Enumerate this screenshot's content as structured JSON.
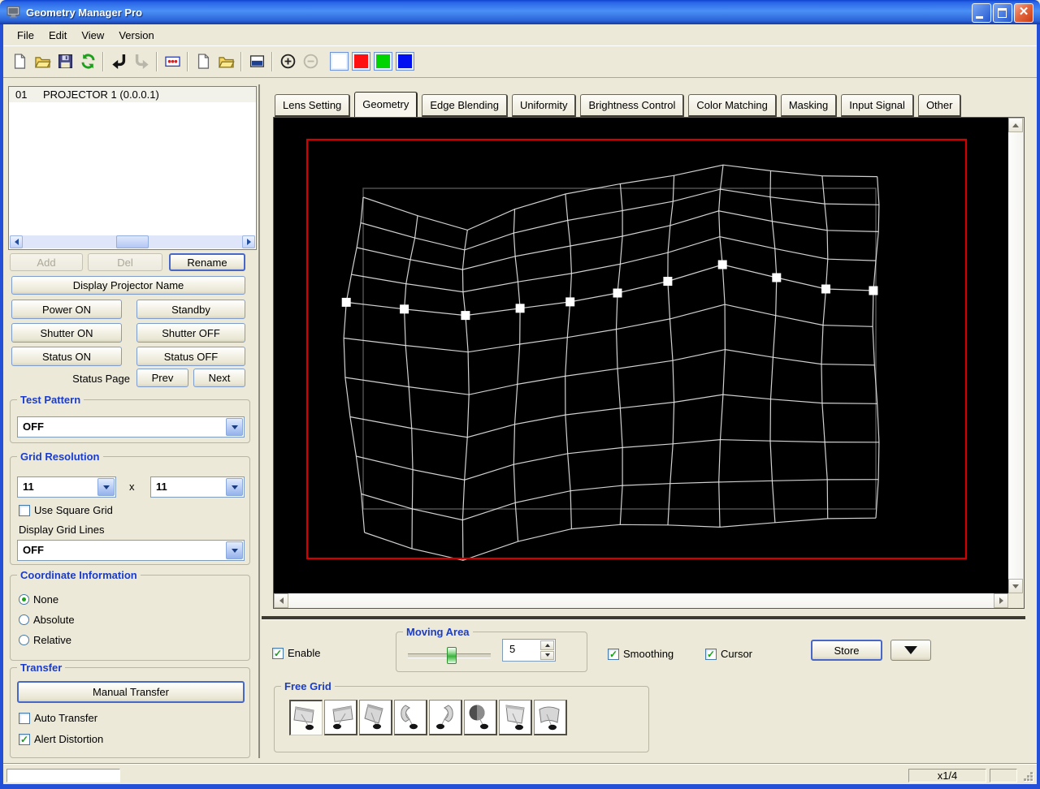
{
  "window": {
    "title": "Geometry Manager Pro"
  },
  "menu": {
    "items": [
      "File",
      "Edit",
      "View",
      "Version"
    ]
  },
  "toolbar": {
    "buttons": [
      "new-file",
      "open-file",
      "save-file",
      "refresh",
      "|",
      "undo-arrow",
      "redo-arrow",
      "|",
      "display-colors",
      "|",
      "new-page",
      "open-folder",
      "|",
      "screen-window",
      "|",
      "zoom-in",
      "zoom-out"
    ],
    "swatches": [
      {
        "name": "white-swatch",
        "color": "#ffffff"
      },
      {
        "name": "red-swatch",
        "color": "#ff1010"
      },
      {
        "name": "green-swatch",
        "color": "#00d400"
      },
      {
        "name": "blue-swatch",
        "color": "#0010f0"
      }
    ]
  },
  "projector_list": {
    "items": [
      {
        "no": "01",
        "name": "PROJECTOR 1 (0.0.0.1)"
      }
    ]
  },
  "left_panel": {
    "add": "Add",
    "del": "Del",
    "rename": "Rename",
    "display_projector_name": "Display Projector Name",
    "power_on": "Power ON",
    "standby": "Standby",
    "shutter_on": "Shutter ON",
    "shutter_off": "Shutter OFF",
    "status_on": "Status ON",
    "status_off": "Status OFF",
    "status_page": "Status Page",
    "prev": "Prev",
    "next": "Next",
    "test_pattern": {
      "label": "Test Pattern",
      "value": "OFF"
    },
    "grid_resolution": {
      "label": "Grid Resolution",
      "cols": "11",
      "times": "x",
      "rows": "11",
      "use_square_grid": "Use Square Grid",
      "display_grid_lines": "Display Grid Lines",
      "grid_lines_value": "OFF"
    },
    "coordinate_information": {
      "label": "Coordinate Information",
      "none": "None",
      "absolute": "Absolute",
      "relative": "Relative",
      "selected": "None"
    },
    "transfer": {
      "label": "Transfer",
      "manual": "Manual Transfer",
      "auto": "Auto Transfer",
      "alert": "Alert Distortion",
      "auto_checked": false,
      "alert_checked": true
    }
  },
  "tabs": {
    "items": [
      "Lens Setting",
      "Geometry",
      "Edge Blending",
      "Uniformity",
      "Brightness Control",
      "Color Matching",
      "Masking",
      "Input Signal",
      "Other"
    ],
    "active": "Geometry"
  },
  "canvas": {
    "background": "#000000",
    "outline_color": "#d40000",
    "reference_color": "#4f4f4f",
    "line_color": "#e2e2e2",
    "handle_color": "#ffffff",
    "grid": {
      "cols": 11,
      "rows": 11,
      "selected_row": 4,
      "dip": [
        20,
        40,
        55,
        32,
        16,
        8,
        4,
        0,
        0,
        0,
        0
      ],
      "dip_scale": [
        1.0,
        0.75,
        0.5,
        0.3,
        0.12,
        0.2,
        0.4,
        0.6,
        0.8,
        0.95,
        1.1
      ],
      "up": [
        -20,
        -14,
        -8,
        -14,
        -20,
        -30,
        -44,
        -64,
        -48,
        -34,
        -32
      ],
      "up_scale": [
        0.45,
        0.6,
        0.8,
        0.92,
        1.0,
        0.85,
        0.6,
        0.35,
        0.1,
        -0.1,
        -0.35
      ]
    }
  },
  "bottom_panel": {
    "enable": "Enable",
    "moving_area": {
      "label": "Moving Area",
      "value": "5"
    },
    "smoothing": "Smoothing",
    "cursor": "Cursor",
    "store": "Store",
    "free_grid": {
      "label": "Free Grid",
      "modes": [
        "flat-screen-left",
        "flat-screen-right",
        "tilted-screen",
        "cylinder-concave",
        "cylinder-open",
        "dome",
        "angled-screen",
        "curved-screen"
      ],
      "selected": "flat-screen-left"
    }
  },
  "status_bar": {
    "scale": "x1/4"
  }
}
